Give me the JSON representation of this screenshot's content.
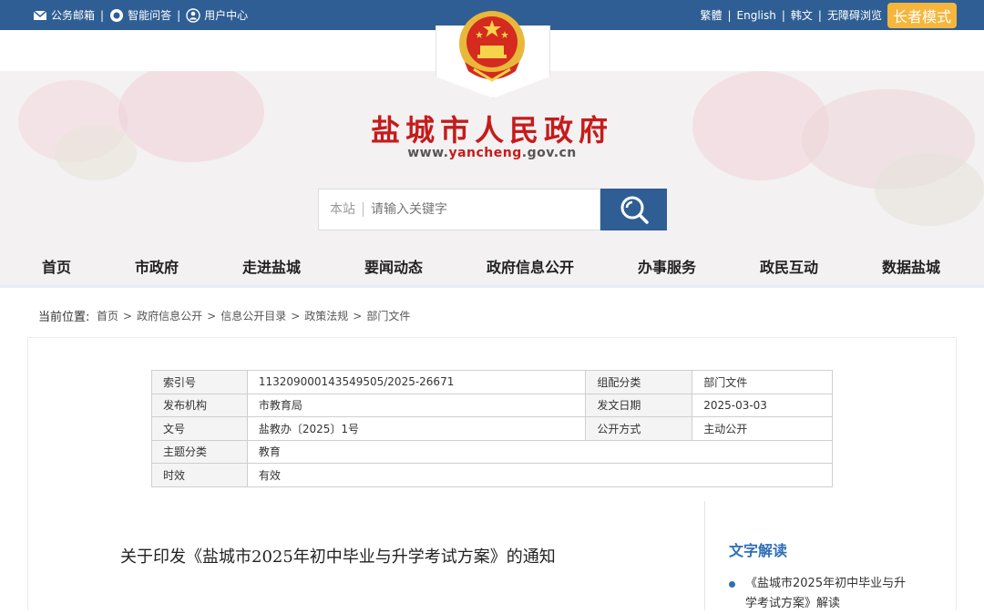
{
  "topbar": {
    "links": [
      "公务邮箱",
      "智能问答",
      "用户中心"
    ],
    "lang": [
      "繁體",
      "English",
      "韩文",
      "无障碍浏览"
    ],
    "elder_mode": "长者模式"
  },
  "header": {
    "site_title": "盐城市人民政府",
    "url_prefix": "www.",
    "url_brand": "yancheng",
    "url_suffix": ".gov.cn"
  },
  "search": {
    "scope": "本站",
    "placeholder": "请输入关键字"
  },
  "nav": [
    "首页",
    "市政府",
    "走进盐城",
    "要闻动态",
    "政府信息公开",
    "办事服务",
    "政民互动",
    "数据盐城"
  ],
  "breadcrumb": {
    "lead": "当前位置:",
    "items": [
      "首页",
      "政府信息公开",
      "信息公开目录",
      "政策法规",
      "部门文件"
    ]
  },
  "meta": {
    "index_label": "索引号",
    "index_value": "113209000143549505/2025-26671",
    "category_label": "组配分类",
    "category_value": "部门文件",
    "publisher_label": "发布机构",
    "publisher_value": "市教育局",
    "date_label": "发文日期",
    "date_value": "2025-03-03",
    "docno_label": "文号",
    "docno_value": "盐教办〔2025〕1号",
    "open_label": "公开方式",
    "open_value": "主动公开",
    "topic_label": "主题分类",
    "topic_value": "教育",
    "validity_label": "时效",
    "validity_value": "有效"
  },
  "document": {
    "title": "关于印发《盐城市2025年初中毕业与升学考试方案》的通知"
  },
  "sidebar": {
    "heading": "文字解读",
    "item": "《盐城市2025年初中毕业与升学考试方案》解读"
  },
  "colors": {
    "topbar": "#2f5e94",
    "title_red": "#c61b1b",
    "accent_blue": "#2f6fb7",
    "elder": "#f6b63c"
  }
}
